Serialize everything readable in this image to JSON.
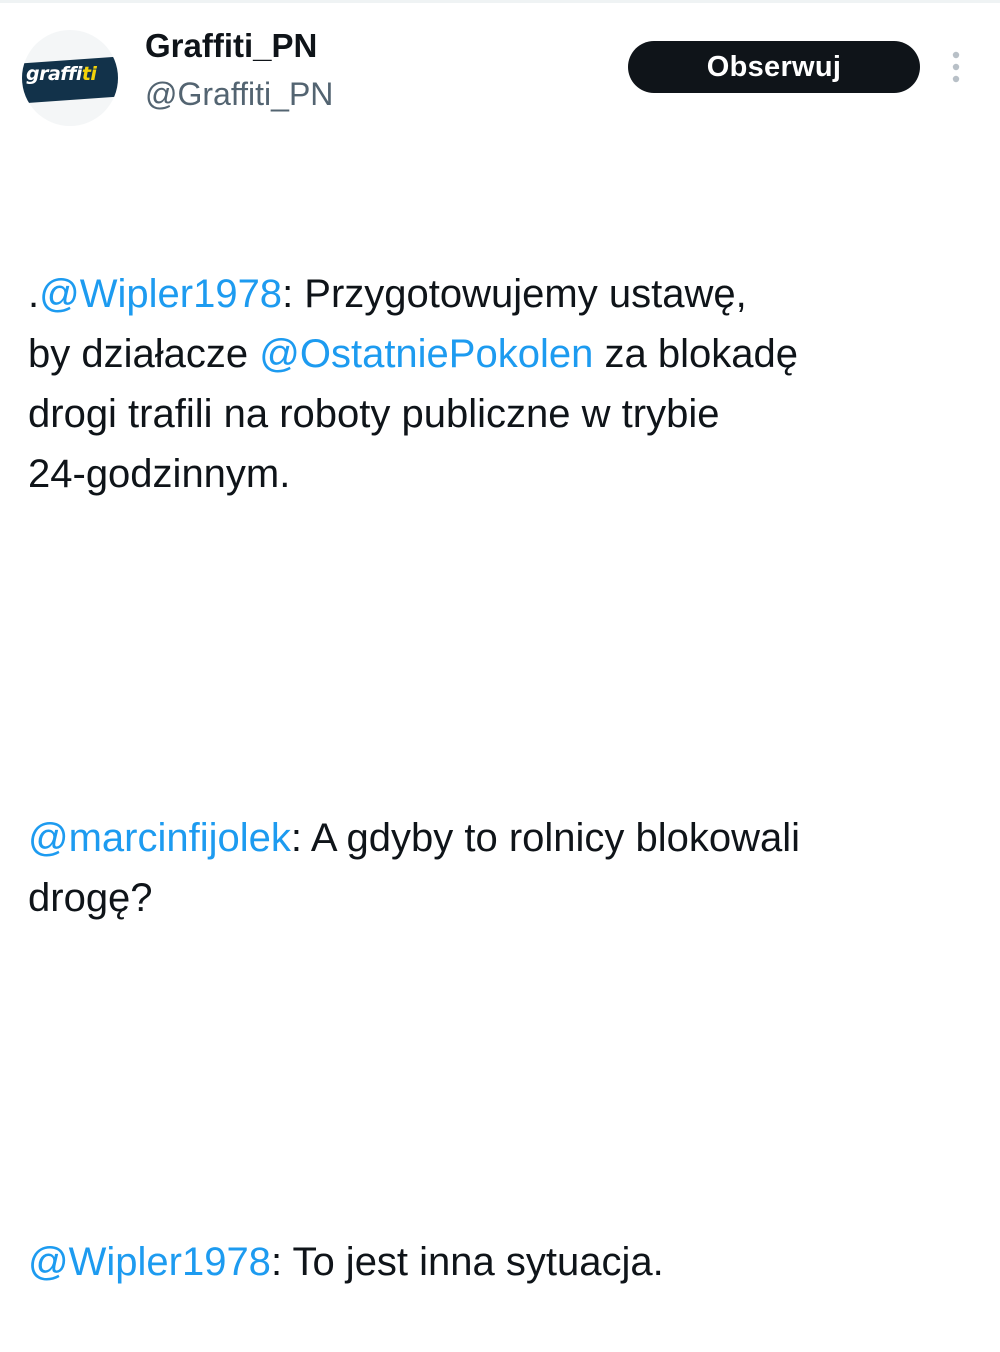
{
  "account": {
    "avatar_label": "graffiti",
    "display_name": "Graffiti_PN",
    "handle": "@Graffiti_PN"
  },
  "actions": {
    "follow_label": "Obserwuj",
    "more_icon": "more-vertical-icon"
  },
  "tweet": {
    "p1": {
      "dot": ".",
      "m1": "@Wipler1978",
      "t1": ": Przygotowujemy ustawę,\nby działacze ",
      "m2": "@OstatniePokolen",
      "t2": " za blokadę\ndrogi trafili na roboty publiczne w trybie\n24-godzinnym."
    },
    "p2": {
      "m1": "@marcinfijolek",
      "t1": ": A gdyby to rolnicy blokowali\ndrogę?"
    },
    "p3": {
      "m1": "@Wipler1978",
      "t1": ": To jest inna sytuacja."
    }
  },
  "colors": {
    "mention": "#1d9bf0",
    "text": "#0f1419",
    "secondary": "#536471",
    "button_bg": "#0f1419",
    "avatar_band": "#12324a",
    "avatar_accent": "#f2d20a"
  }
}
